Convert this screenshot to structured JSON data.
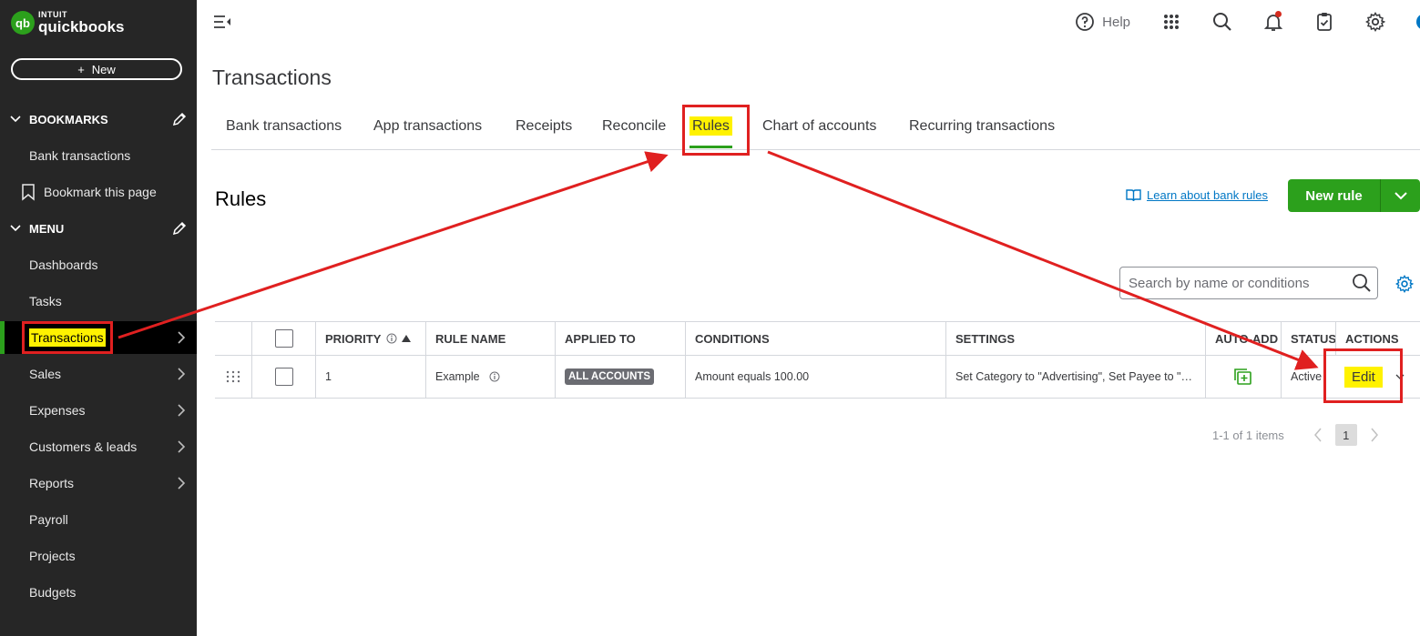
{
  "logo": {
    "brand_top": "INTUIT",
    "brand_name": "quickbooks",
    "mark": "qb"
  },
  "sidebar": {
    "new_label": "New",
    "bookmarks_header": "BOOKMARKS",
    "bookmarks": [
      {
        "label": "Bank transactions"
      },
      {
        "label": "Bookmark this page"
      }
    ],
    "menu_header": "MENU",
    "items": [
      {
        "label": "Dashboards",
        "has_arrow": false
      },
      {
        "label": "Tasks",
        "has_arrow": false
      },
      {
        "label": "Transactions",
        "has_arrow": true,
        "active": true
      },
      {
        "label": "Sales",
        "has_arrow": true
      },
      {
        "label": "Expenses",
        "has_arrow": true
      },
      {
        "label": "Customers & leads",
        "has_arrow": true
      },
      {
        "label": "Reports",
        "has_arrow": true
      },
      {
        "label": "Payroll",
        "has_arrow": false
      },
      {
        "label": "Projects",
        "has_arrow": false
      },
      {
        "label": "Budgets",
        "has_arrow": false
      }
    ]
  },
  "topbar": {
    "help_label": "Help",
    "icons": [
      "apps-grid-icon",
      "search-icon",
      "bell-icon",
      "clipboard-icon",
      "gear-icon"
    ]
  },
  "page": {
    "title": "Transactions"
  },
  "tabs": [
    {
      "label": "Bank transactions"
    },
    {
      "label": "App transactions"
    },
    {
      "label": "Receipts"
    },
    {
      "label": "Reconcile"
    },
    {
      "label": "Rules",
      "active": true
    },
    {
      "label": "Chart of accounts"
    },
    {
      "label": "Recurring transactions"
    }
  ],
  "rules": {
    "heading": "Rules",
    "learn_link": "Learn about bank rules",
    "new_rule_label": "New rule",
    "search_placeholder": "Search by name or conditions"
  },
  "table": {
    "columns": {
      "priority": "PRIORITY",
      "rule_name": "RULE NAME",
      "applied_to": "APPLIED TO",
      "conditions": "CONDITIONS",
      "settings": "SETTINGS",
      "auto_add": "AUTO-ADD",
      "status": "STATUS",
      "actions": "ACTIONS"
    },
    "rows": [
      {
        "priority": "1",
        "rule_name": "Example",
        "applied_to": "ALL ACCOUNTS",
        "conditions": "Amount equals 100.00",
        "settings": "Set Category to \"Advertising\", Set Payee to \"…",
        "status": "Active",
        "action": "Edit"
      }
    ]
  },
  "pagination": {
    "summary": "1-1 of 1 items",
    "current_page": "1"
  },
  "colors": {
    "accent_green": "#2ca01c",
    "highlight": "#fff200",
    "annotation_red": "#e02020",
    "sidebar_bg": "#262626"
  }
}
